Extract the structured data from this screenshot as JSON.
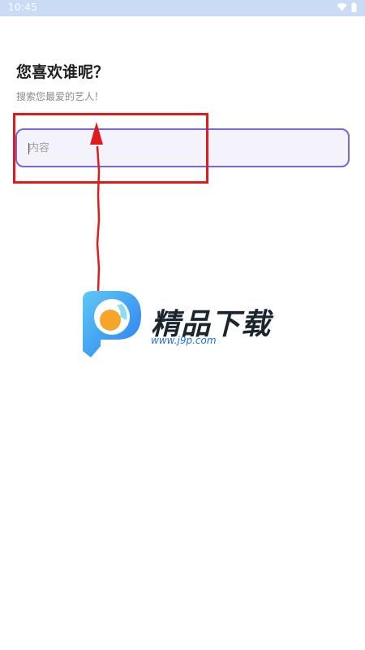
{
  "status_bar": {
    "time": "10:45",
    "icons": [
      "wifi-icon",
      "battery-icon"
    ],
    "background": "#c9dbf5"
  },
  "header": {
    "title": "您喜欢谁呢？",
    "subtitle": "搜索您最爱的艺人！"
  },
  "search": {
    "placeholder": "内容",
    "value": "",
    "border_color": "#7a64e0",
    "background": "#f4f3fc"
  },
  "annotation": {
    "color": "#e01b1b"
  },
  "watermark": {
    "brand": "精品下载",
    "url": "www.j9p.com"
  }
}
